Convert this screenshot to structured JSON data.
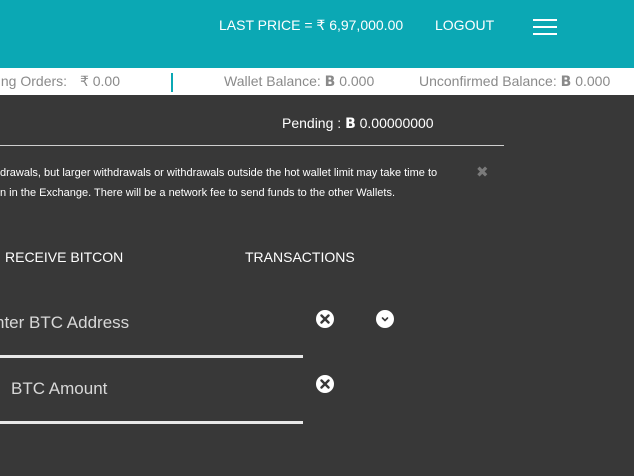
{
  "header": {
    "last_price": "LAST PRICE = ₹ 6,97,000.00",
    "logout_label": "LOGOUT",
    "menu_icon": "hamburger-icon"
  },
  "ticker": {
    "pending_orders_label": "ding Orders:",
    "pending_orders_value": "₹ 0.00",
    "wallet_balance_label": "Wallet Balance:",
    "wallet_balance_value": "0.000",
    "unconfirmed_balance_label": "Unconfirmed Balance:",
    "unconfirmed_balance_value": "0.000",
    "btc_symbol": "B"
  },
  "pending": {
    "label": "Pending :",
    "value": "0.00000000"
  },
  "notice": {
    "line1": "drawals, but larger withdrawals or withdrawals outside the hot wallet limit may take time to",
    "line2": "n in the Exchange. There will be a network fee to send funds to the other Wallets.",
    "close_glyph": "✖"
  },
  "tabs": {
    "receive": "RECEIVE BITCON",
    "transactions": "TRANSACTIONS"
  },
  "form": {
    "address_placeholder": "nter BTC Address",
    "amount_placeholder": "BTC Amount"
  },
  "colors": {
    "accent": "#0ba8b4",
    "background": "#383838"
  }
}
